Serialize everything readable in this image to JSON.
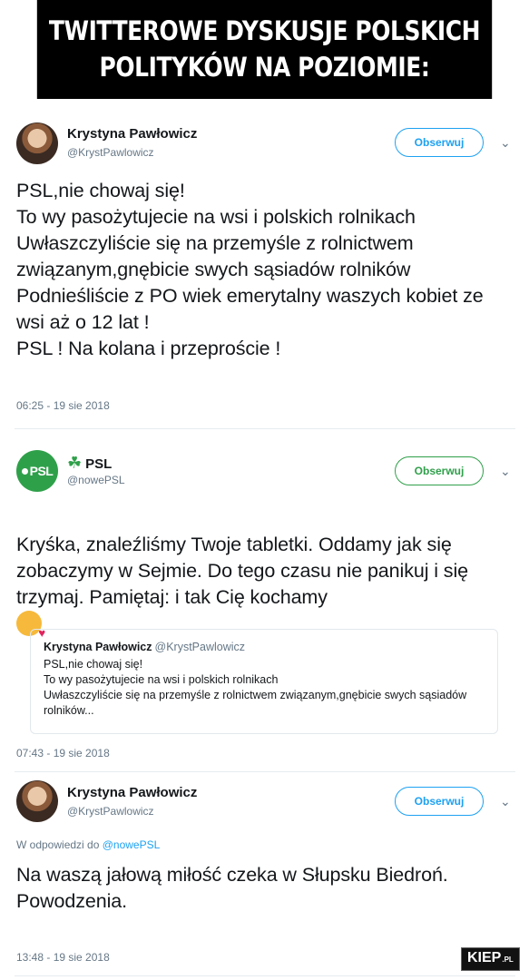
{
  "banner": {
    "line1": "TWITTEROWE DYSKUSJE POLSKICH",
    "line2": "POLITYKÓW NA POZIOMIE:"
  },
  "tweets": [
    {
      "name": "Krystyna Pawłowicz",
      "handle": "@KrystPawlowicz",
      "follow_label": "Obserwuj",
      "text": "PSL,nie chowaj się!\nTo wy pasożytujecie na wsi i polskich rolnikach\nUwłaszczyliście się na przemyśle z rolnictwem związanym,gnębicie swych sąsiadów rolników\nPodnieśliście z PO wiek emerytalny waszych kobiet ze wsi aż o 12 lat !\nPSL ! Na kolana i przeproście !",
      "timestamp": "06:25 - 19 sie 2018"
    },
    {
      "name": "PSL",
      "handle": "@nowePSL",
      "avatar_text": "PSL",
      "follow_label": "Obserwuj",
      "text": "Kryśka, znaleźliśmy Twoje tabletki. Oddamy jak się zobaczymy w Sejmie. Do tego czasu nie panikuj i się trzymaj. Pamiętaj: i tak Cię kochamy",
      "quote": {
        "name": "Krystyna Pawłowicz",
        "handle": "@KrystPawlowicz",
        "text": "PSL,nie chowaj się!\nTo wy pasożytujecie na wsi i polskich rolnikach\nUwłaszczyliście się na przemyśle z rolnictwem związanym,gnębicie swych sąsiadów rolników..."
      },
      "timestamp": "07:43 - 19 sie 2018"
    },
    {
      "name": "Krystyna Pawłowicz",
      "handle": "@KrystPawlowicz",
      "follow_label": "Obserwuj",
      "reply_prefix": "W odpowiedzi do",
      "reply_handle": "@nowePSL",
      "text": "Na waszą jałową miłość czeka w Słupsku Biedroń.\nPowodzenia.",
      "timestamp": "13:48 - 19 sie 2018"
    }
  ],
  "watermark": {
    "main": "KIEP",
    "suffix": ".PL"
  },
  "colors": {
    "twitter_blue": "#1da1f2",
    "psl_green": "#2fa04a",
    "muted": "#657786"
  },
  "icons": [
    "chevron-down-icon",
    "clover-icon",
    "kiss-emoji-icon"
  ]
}
